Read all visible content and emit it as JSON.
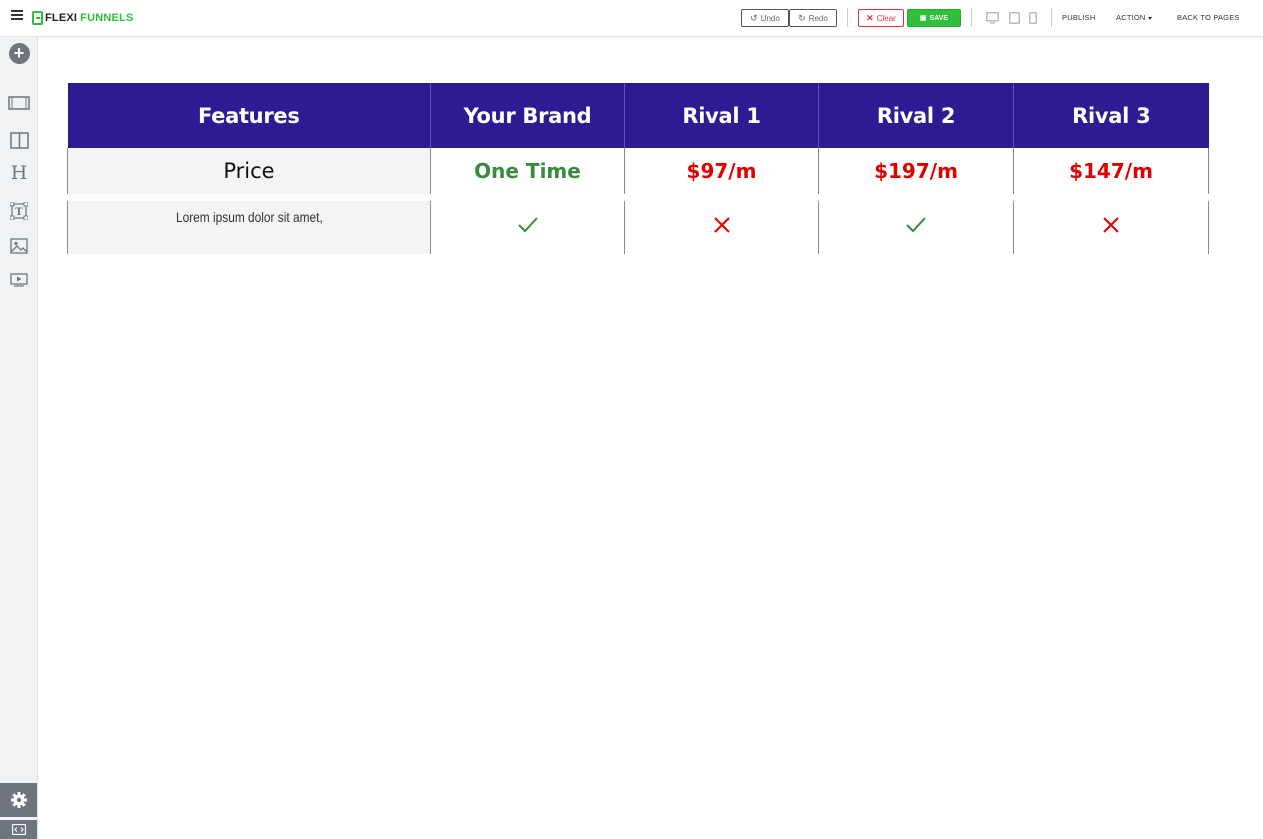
{
  "app": {
    "logo_part1": "FLEXI",
    "logo_part2": "FUNNELS"
  },
  "toolbar": {
    "undo_label": "Undo",
    "redo_label": "Redo",
    "clear_label": "Clear",
    "save_label": "SAVE",
    "publish_label": "PUBLISH",
    "action_label": "ACTION",
    "back_label": "BACK TO PAGES"
  },
  "colors": {
    "header_bg": "#2e1a92",
    "brand_green": "#3a8a3e",
    "rival_red": "#e00000",
    "save_green": "#2fbf3a"
  },
  "table": {
    "headers": [
      "Features",
      "Your Brand",
      "Rival 1",
      "Rival 2",
      "Rival 3"
    ],
    "price_row": {
      "label": "Price",
      "values": [
        "One Time",
        "$97/m",
        "$197/m",
        "$147/m"
      ]
    },
    "feature_rows": [
      {
        "label": "Lorem ipsum dolor sit amet,",
        "marks": [
          "check",
          "cross",
          "check",
          "cross"
        ]
      }
    ]
  },
  "sidebar": {
    "icons": [
      "add-icon",
      "section-icon",
      "columns-icon",
      "heading-icon",
      "text-icon",
      "image-icon",
      "video-icon",
      "settings-icon",
      "code-icon"
    ]
  }
}
